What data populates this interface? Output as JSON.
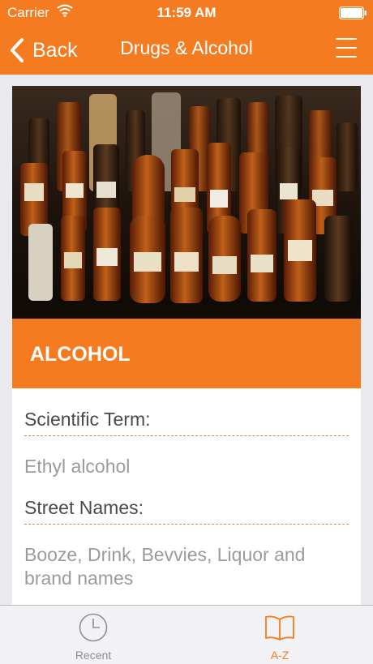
{
  "status_bar": {
    "carrier": "Carrier",
    "time": "11:59 AM"
  },
  "nav": {
    "back_label": "Back",
    "title": "Drugs & Alcohol"
  },
  "detail": {
    "heading": "ALCOHOL",
    "fields": [
      {
        "label": "Scientific Term:",
        "value": "Ethyl alcohol"
      },
      {
        "label": "Street Names:",
        "value": "Booze, Drink, Bevvies, Liquor and brand names"
      }
    ]
  },
  "tabs": [
    {
      "label": "Recent",
      "icon": "clock-icon",
      "selected": false
    },
    {
      "label": "A-Z",
      "icon": "book-icon",
      "selected": true
    }
  ],
  "colors": {
    "accent": "#f47b20",
    "tab_inactive": "#8e8e93"
  }
}
